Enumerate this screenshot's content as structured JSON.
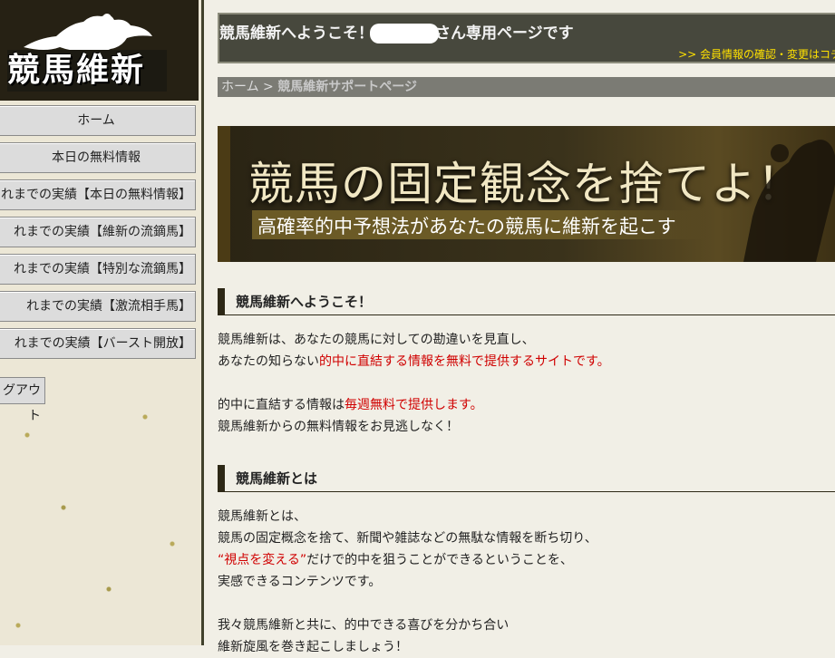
{
  "logo": {
    "text": "競馬維新"
  },
  "sidebar": {
    "items": [
      {
        "label": "ホーム"
      },
      {
        "label": "本日の無料情報"
      },
      {
        "label": "れまでの実績【本日の無料情報】"
      },
      {
        "label": "れまでの実績【維新の流鏑馬】"
      },
      {
        "label": "れまでの実績【特別な流鏑馬】"
      },
      {
        "label": "れまでの実績【激流相手馬】"
      },
      {
        "label": "れまでの実績【バースト開放】"
      }
    ],
    "logout_label": "グアウト"
  },
  "header": {
    "welcome_prefix": "競馬維新へようこそ！",
    "welcome_suffix": "さん専用ページです",
    "member_link": ">> 会員情報の確認・変更はコチ"
  },
  "breadcrumb": {
    "home": "ホーム",
    "separator": " > ",
    "current": "競馬維新サポートページ"
  },
  "banner": {
    "heading": "競馬の固定観念を捨てよ！",
    "subheading": "高確率的中予想法があなたの競馬に維新を起こす"
  },
  "sections": [
    {
      "title": "競馬維新へようこそ！",
      "lines": [
        {
          "plain": "競馬維新は、あなたの競馬に対しての勘違いを見直し、",
          "red": "",
          "tail": ""
        },
        {
          "plain": "あなたの知らない",
          "red": "的中に直結する情報を無料で提供するサイトです。",
          "tail": ""
        },
        {
          "plain": "",
          "red": "",
          "tail": ""
        },
        {
          "plain": "的中に直結する情報は",
          "red": "毎週無料で提供します。",
          "tail": ""
        },
        {
          "plain": "競馬維新からの無料情報をお見逃しなく！",
          "red": "",
          "tail": ""
        }
      ]
    },
    {
      "title": "競馬維新とは",
      "lines": [
        {
          "plain": "競馬維新とは、",
          "red": "",
          "tail": ""
        },
        {
          "plain": "競馬の固定概念を捨て、新聞や雑誌などの無駄な情報を断ち切り、",
          "red": "",
          "tail": ""
        },
        {
          "plain": "",
          "red": "“視点を変える”",
          "tail": "だけで的中を狙うことができるということを、"
        },
        {
          "plain": "実感できるコンテンツです。",
          "red": "",
          "tail": ""
        },
        {
          "plain": "",
          "red": "",
          "tail": ""
        },
        {
          "plain": "我々競馬維新と共に、的中できる喜びを分かち合い",
          "red": "",
          "tail": ""
        },
        {
          "plain": "維新旋風を巻き起こしましょう！",
          "red": "",
          "tail": ""
        }
      ]
    }
  ]
}
